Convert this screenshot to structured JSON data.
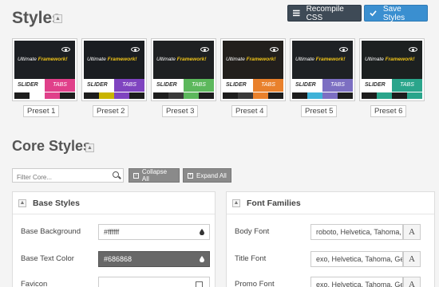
{
  "header": {
    "title": "Styles",
    "collapse_label": "▲"
  },
  "actions": {
    "recompile_label": "Recompile CSS",
    "save_label": "Save Styles"
  },
  "presets": [
    {
      "label": "Preset 1",
      "hero_color": "#1c1f23",
      "tabs_color": "#e0408a",
      "strip": [
        "#1d1d1d",
        "#ffffff",
        "#e0408a",
        "#1d1d1d"
      ]
    },
    {
      "label": "Preset 2",
      "hero_color": "#1a1d21",
      "tabs_color": "#7f44c0",
      "strip": [
        "#1d1d1d",
        "#c9b400",
        "#7f44c0",
        "#1d1d1d"
      ]
    },
    {
      "label": "Preset 3",
      "hero_color": "#1e2022",
      "tabs_color": "#5cb85c",
      "strip": [
        "#1d1d1d",
        "#3a3a3a",
        "#5cb85c",
        "#1d1d1d"
      ]
    },
    {
      "label": "Preset 4",
      "hero_color": "#221f1c",
      "tabs_color": "#e9812c",
      "strip": [
        "#1d1d1d",
        "#3a3a3a",
        "#e9812c",
        "#1d1d1d"
      ]
    },
    {
      "label": "Preset 5",
      "hero_color": "#1e2124",
      "tabs_color": "#7c6fc2",
      "strip": [
        "#1d1d1d",
        "#3fb2d8",
        "#7c6fc2",
        "#1d1d1d"
      ]
    },
    {
      "label": "Preset 6",
      "hero_color": "#1c2020",
      "tabs_color": "#2aa58b",
      "strip": [
        "#1d1d1d",
        "#2aa58b",
        "#1d1d1d",
        "#2aa58b"
      ]
    }
  ],
  "preset_thumb": {
    "hero_prefix": "Ultimate ",
    "hero_highlight": "Framework!",
    "slider": "SLIDER",
    "tabs": "TABS",
    "highlight_color": "#f0c419"
  },
  "core": {
    "title": "Core Styles",
    "filter_placeholder": "Filter Core...",
    "collapse_all": "Collapse All",
    "expand_all": "Expand All"
  },
  "base_styles": {
    "title": "Base Styles",
    "rows": [
      {
        "label": "Base Background",
        "value": "#ffffff"
      },
      {
        "label": "Base Text Color",
        "value": "#686868"
      },
      {
        "label": "Favicon",
        "value": ""
      }
    ]
  },
  "font_families": {
    "title": "Font Families",
    "rows": [
      {
        "label": "Body Font",
        "value": "roboto, Helvetica, Tahoma, Geneva, Arial, sans-serif"
      },
      {
        "label": "Title Font",
        "value": "exo, Helvetica, Tahoma, Geneva, Arial, sans-serif"
      },
      {
        "label": "Promo Font",
        "value": "exo, Helvetica, Tahoma, Geneva, Arial, sans-serif"
      }
    ],
    "addon_label": "A"
  }
}
